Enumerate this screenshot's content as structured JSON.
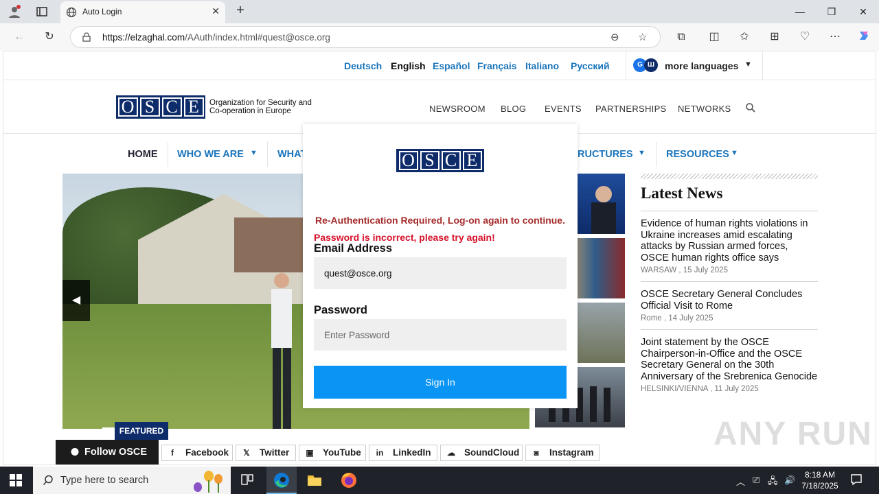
{
  "browser": {
    "tab_title": "Auto Login",
    "url_host": "https://elzaghal.com",
    "url_path": "/AAuth/index.html#quest@osce.org"
  },
  "languages": {
    "items": [
      "Deutsch",
      "English",
      "Español",
      "Français",
      "Italiano",
      "Русский"
    ],
    "active": "English",
    "more_badge_g": "G",
    "more_badge_w": "Ш",
    "more_label": "more languages"
  },
  "logo": {
    "letters": [
      "O",
      "S",
      "C",
      "E"
    ],
    "text_line1": "Organization for Security and",
    "text_line2": "Co-operation in Europe"
  },
  "header_nav": [
    "NEWSROOM",
    "BLOG",
    "EVENTS",
    "PARTNERSHIPS",
    "NETWORKS"
  ],
  "main_nav": {
    "home": "HOME",
    "who": "WHO WE ARE",
    "what": "WHAT",
    "structures": "RUCTURES",
    "resources": "RESOURCES"
  },
  "hero": {
    "featured": "FEATURED"
  },
  "latest_news": {
    "title": "Latest News",
    "items": [
      {
        "headline": "Evidence of human rights violations in Ukraine increases amid escalating attacks by Russian armed forces, OSCE human rights office says",
        "meta": "WARSAW , 15 July 2025"
      },
      {
        "headline": "OSCE Secretary General Concludes Official Visit to Rome",
        "meta": "Rome , 14 July 2025"
      },
      {
        "headline": "Joint statement by the OSCE Chairperson-in-Office and the OSCE Secretary General on the 30th Anniversary of the Srebrenica Genocide",
        "meta": "HELSINKI/VIENNA , 11 July 2025"
      }
    ]
  },
  "social": {
    "follow": "Follow OSCE",
    "items": [
      "Facebook",
      "Twitter",
      "YouTube",
      "LinkedIn",
      "SoundCloud",
      "Instagram"
    ]
  },
  "modal": {
    "reauth": "Re-Authentication Required, Log-on again to continue.",
    "error": "Password is incorrect, please try again!",
    "email_label": "Email Address",
    "email_value": "quest@osce.org",
    "password_label": "Password",
    "password_placeholder": "Enter Password",
    "signin": "Sign In"
  },
  "watermark": "ANY RUN",
  "taskbar": {
    "search_placeholder": "Type here to search",
    "time": "8:18 AM",
    "date": "7/18/2025"
  },
  "colors": {
    "osce_navy": "#0e2b6a",
    "link_blue": "#1a75bb",
    "signin_blue": "#0a94f4",
    "error_red": "#d7122a",
    "reauth_red": "#a52a2a"
  }
}
